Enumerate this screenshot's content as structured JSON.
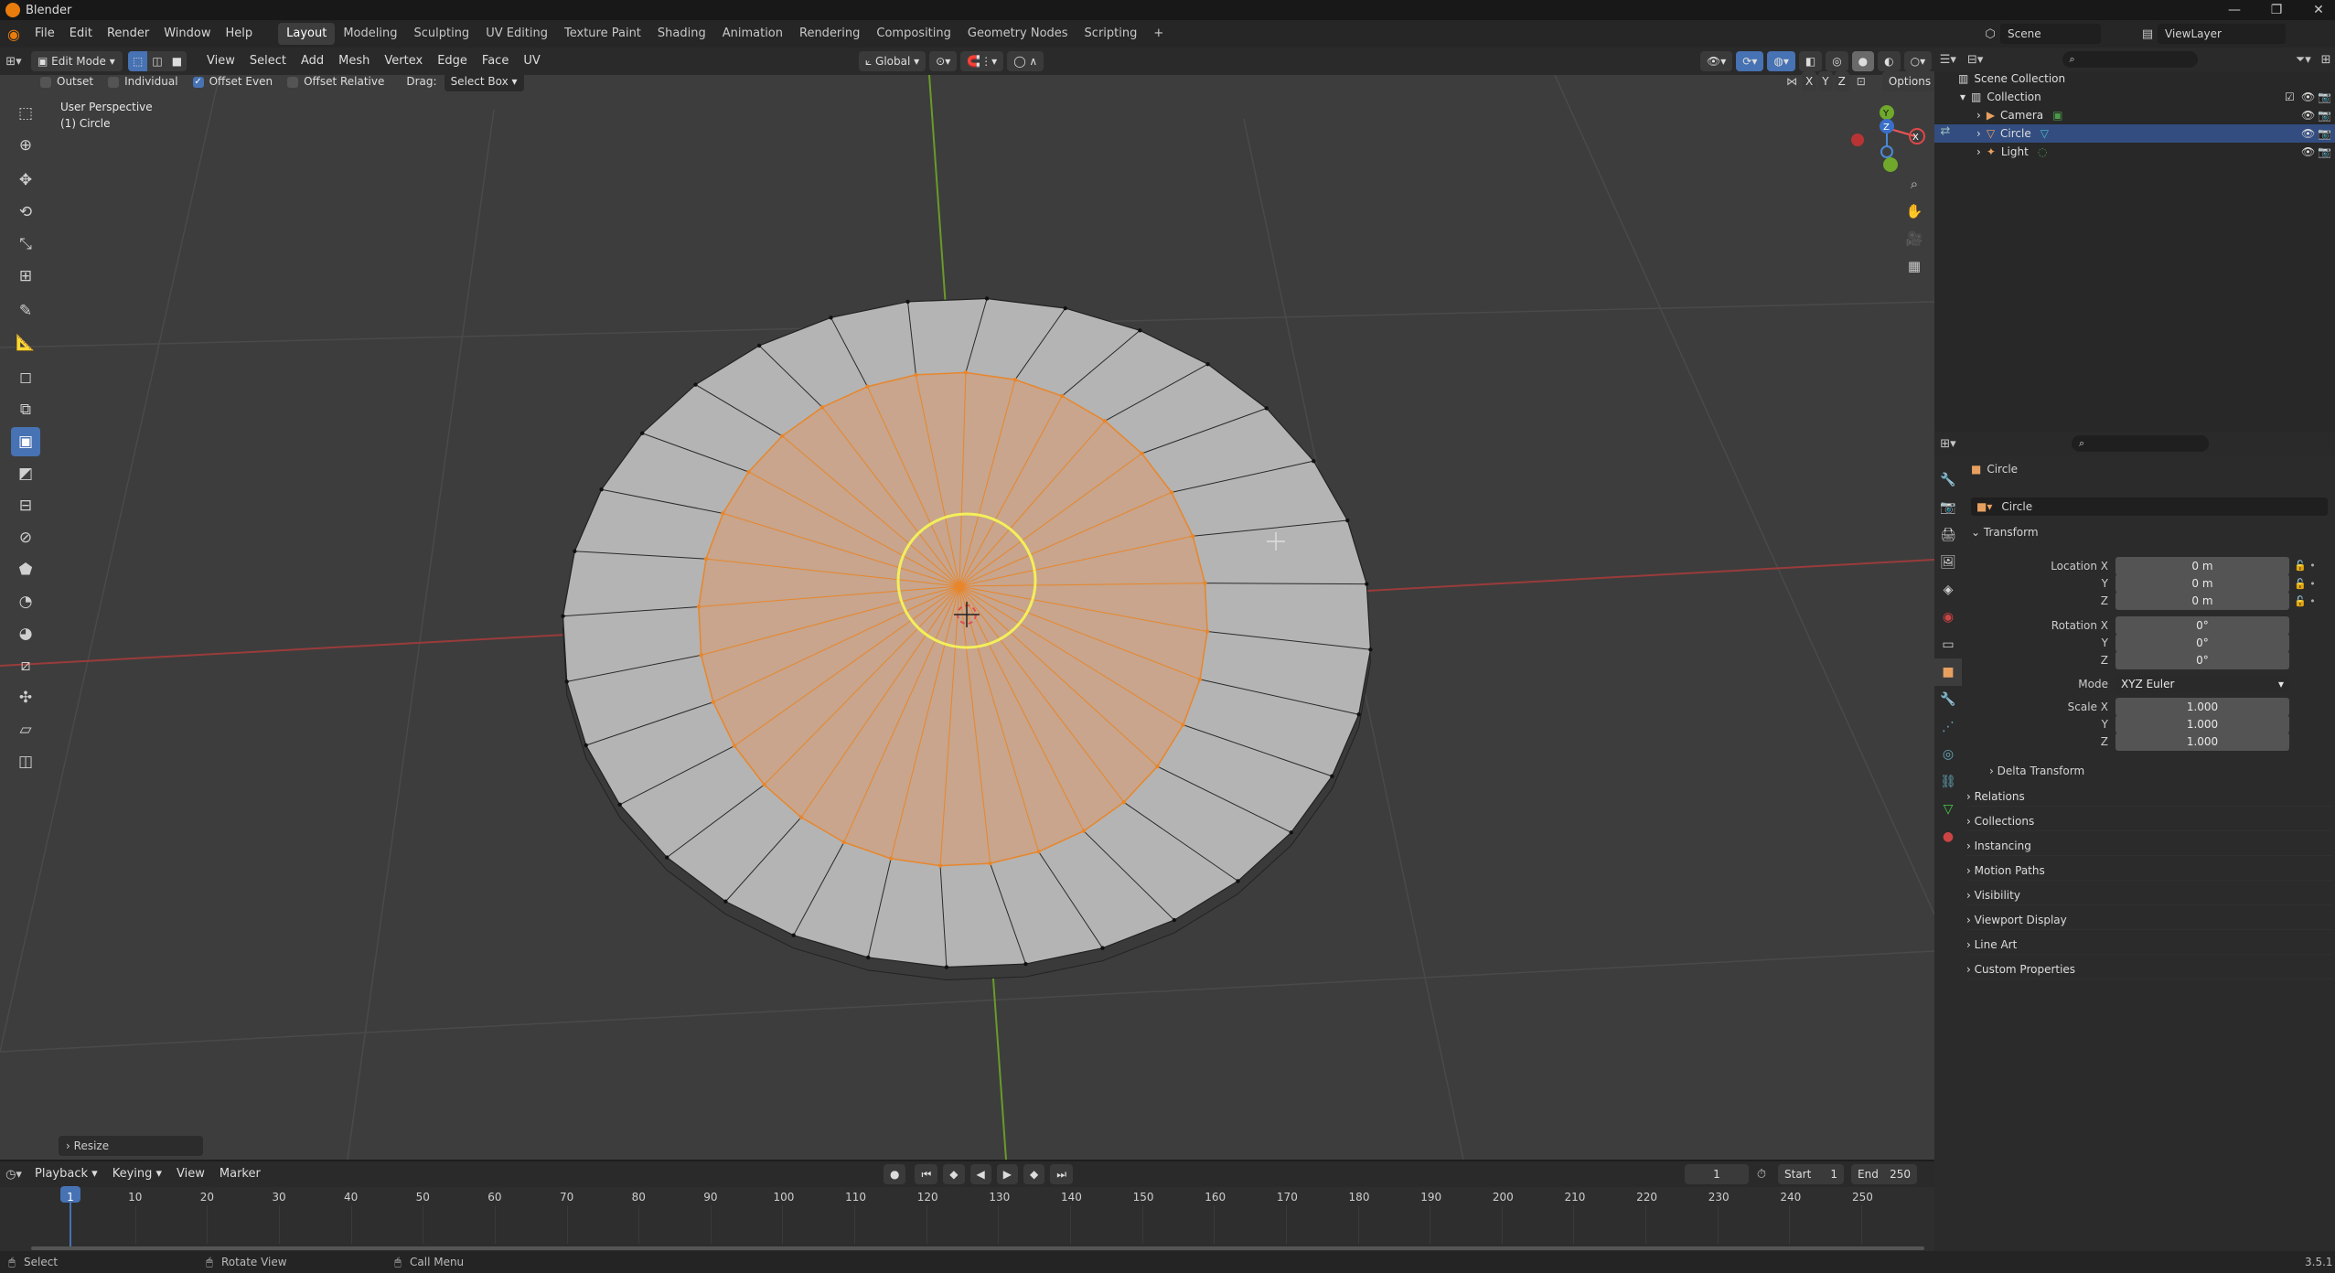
{
  "window": {
    "title": "Blender",
    "controls": [
      "—",
      "❐",
      "✕"
    ]
  },
  "topbar": {
    "menus": [
      "File",
      "Edit",
      "Render",
      "Window",
      "Help"
    ],
    "workspaces": [
      "Layout",
      "Modeling",
      "Sculpting",
      "UV Editing",
      "Texture Paint",
      "Shading",
      "Animation",
      "Rendering",
      "Compositing",
      "Geometry Nodes",
      "Scripting"
    ],
    "active_workspace": "Layout",
    "add_tab": "+",
    "scene": "Scene",
    "view_layer": "ViewLayer"
  },
  "viewport_header": {
    "mode": "Edit Mode",
    "menus": [
      "View",
      "Select",
      "Add",
      "Mesh",
      "Vertex",
      "Edge",
      "Face",
      "UV"
    ],
    "transform_orientation": "Global",
    "options_label": "Options",
    "axes": [
      "X",
      "Y",
      "Z"
    ]
  },
  "tool_settings": {
    "outset": {
      "label": "Outset",
      "checked": false
    },
    "individual": {
      "label": "Individual",
      "checked": false
    },
    "offset_even": {
      "label": "Offset Even",
      "checked": true
    },
    "offset_relative": {
      "label": "Offset Relative",
      "checked": false
    },
    "drag_label": "Drag:",
    "drag_value": "Select Box"
  },
  "viewport": {
    "view_name": "User Perspective",
    "object_name": "(1) Circle",
    "last_op": "Resize"
  },
  "outliner": {
    "root": "Scene Collection",
    "collection": "Collection",
    "items": [
      {
        "name": "Camera",
        "color": "#e8a060"
      },
      {
        "name": "Circle",
        "color": "#e8a060",
        "selected": true
      },
      {
        "name": "Light",
        "color": "#e8a060"
      }
    ]
  },
  "properties": {
    "object_name": "Circle",
    "data_name": "Circle",
    "transform_title": "Transform",
    "location": {
      "label": "Location X",
      "labels": [
        "Location X",
        "Y",
        "Z"
      ],
      "values": [
        "0 m",
        "0 m",
        "0 m"
      ]
    },
    "rotation": {
      "labels": [
        "Rotation X",
        "Y",
        "Z"
      ],
      "values": [
        "0°",
        "0°",
        "0°"
      ]
    },
    "mode": {
      "label": "Mode",
      "value": "XYZ Euler"
    },
    "scale": {
      "labels": [
        "Scale X",
        "Y",
        "Z"
      ],
      "values": [
        "1.000",
        "1.000",
        "1.000"
      ]
    },
    "delta": "Delta Transform",
    "sections": [
      "Relations",
      "Collections",
      "Instancing",
      "Motion Paths",
      "Visibility",
      "Viewport Display",
      "Line Art",
      "Custom Properties"
    ]
  },
  "timeline": {
    "menus": [
      "Playback",
      "Keying",
      "View",
      "Marker"
    ],
    "current_frame": "1",
    "start_label": "Start",
    "start": "1",
    "end_label": "End",
    "end": "250",
    "ticks": [
      "1",
      "10",
      "20",
      "30",
      "40",
      "50",
      "60",
      "70",
      "80",
      "90",
      "100",
      "110",
      "120",
      "130",
      "140",
      "150",
      "160",
      "170",
      "180",
      "190",
      "200",
      "210",
      "220",
      "230",
      "240",
      "250"
    ]
  },
  "statusbar": {
    "items": [
      "Select",
      "Rotate View",
      "Call Menu"
    ],
    "version": "3.5.1"
  },
  "colors": {
    "accent": "#4772b3",
    "selection_orange": "#e8862b",
    "circle_yellow": "#f3ef5a"
  }
}
